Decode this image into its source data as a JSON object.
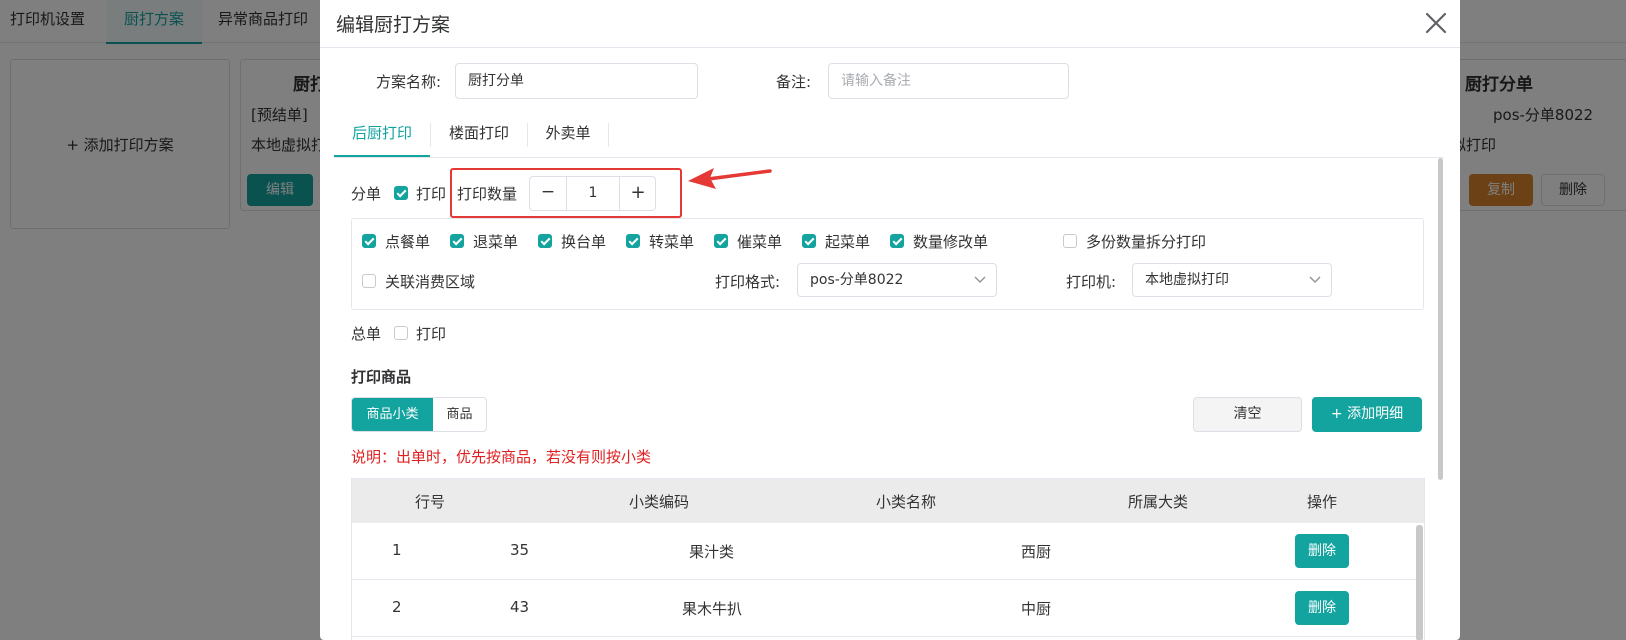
{
  "nav": {
    "tabs": [
      "打印机设置",
      "厨打方案",
      "异常商品打印"
    ]
  },
  "background": {
    "add_plan": "+ 添加打印方案",
    "left_card": {
      "title_fragment": "厨打",
      "line1": "[预结单]",
      "line2": "本地虚拟打",
      "edit": "编辑"
    },
    "right_card": {
      "title": "厨打分单",
      "format": "pos-分单8022",
      "printer": "拟打印",
      "copy": "复制",
      "delete": "删除"
    }
  },
  "dialog": {
    "title": "编辑厨打方案",
    "plan_name_label": "方案名称:",
    "plan_name_value": "厨打分单",
    "remark_label": "备注:",
    "remark_placeholder": "请输入备注",
    "tabs": [
      "后厨打印",
      "楼面打印",
      "外卖单"
    ],
    "split": {
      "label": "分单",
      "print_label": "打印",
      "print_checked": true,
      "qty_label": "打印数量",
      "qty_value": "1",
      "minus": "−",
      "plus": "+"
    },
    "checks_row1": [
      {
        "label": "点餐单",
        "checked": true
      },
      {
        "label": "退菜单",
        "checked": true
      },
      {
        "label": "换台单",
        "checked": true
      },
      {
        "label": "转菜单",
        "checked": true
      },
      {
        "label": "催菜单",
        "checked": true
      },
      {
        "label": "起菜单",
        "checked": true
      },
      {
        "label": "数量修改单",
        "checked": true
      },
      {
        "label": "多份数量拆分打印",
        "checked": false
      }
    ],
    "area_check": {
      "label": "关联消费区域",
      "checked": false
    },
    "format_label": "打印格式:",
    "format_value": "pos-分单8022",
    "printer_label": "打印机:",
    "printer_value": "本地虚拟打印",
    "total": {
      "label": "总单",
      "print_label": "打印",
      "print_checked": false
    },
    "goods_title": "打印商品",
    "seg": {
      "active": "商品小类",
      "other": "商品"
    },
    "clear_btn": "清空",
    "add_btn": "+ 添加明细",
    "note": "说明：出单时，优先按商品，若没有则按小类",
    "table": {
      "headers": [
        "行号",
        "小类编码",
        "小类名称",
        "所属大类",
        "操作"
      ],
      "rows": [
        {
          "no": "1",
          "code": "35",
          "name": "果汁类",
          "category": "西厨",
          "action": "删除"
        },
        {
          "no": "2",
          "code": "43",
          "name": "果木牛扒",
          "category": "中厨",
          "action": "删除"
        }
      ]
    }
  },
  "colors": {
    "accent": "#14a4a0",
    "highlight": "#e53935",
    "note": "#e02020",
    "copy": "#d8822c"
  }
}
